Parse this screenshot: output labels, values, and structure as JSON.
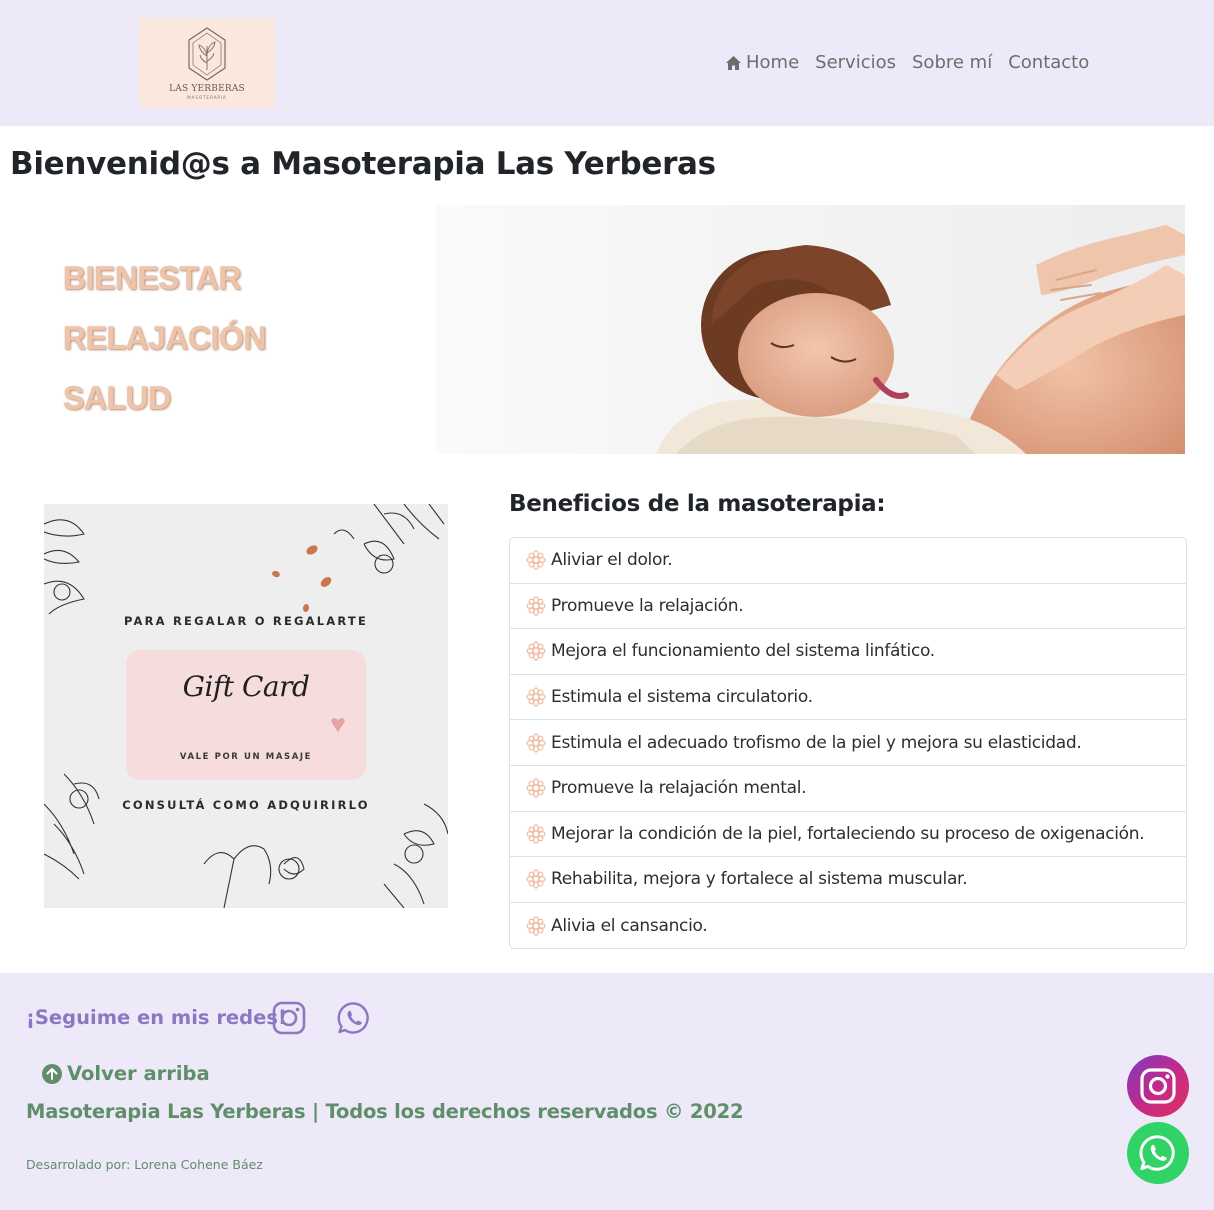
{
  "header": {
    "logo": {
      "name": "LAS YERBERAS",
      "subtitle": "MASOTERAPIA"
    },
    "nav": [
      {
        "label": "Home",
        "icon": "home-icon"
      },
      {
        "label": "Servicios"
      },
      {
        "label": "Sobre mí"
      },
      {
        "label": "Contacto"
      }
    ]
  },
  "main": {
    "title": "Bienvenid@s a Masoterapia Las Yerberas",
    "hero_words": [
      "BIENESTAR",
      "RELAJACIÓN",
      "SALUD"
    ],
    "gift_card": {
      "top_text": "PARA REGALAR O REGALARTE",
      "title": "Gift Card",
      "subtitle": "VALE POR UN MASAJE",
      "bottom_text": "CONSULTÁ COMO ADQUIRIRLO"
    },
    "benefits": {
      "title": "Beneficios de la masoterapia:",
      "items": [
        "Aliviar el dolor.",
        "Promueve la relajación.",
        "Mejora el funcionamiento del sistema linfático.",
        "Estimula el sistema circulatorio.",
        "Estimula el adecuado trofismo de la piel y mejora su elasticidad.",
        "Promueve la relajación mental.",
        "Mejorar la condición de la piel, fortaleciendo su proceso de oxigenación.",
        "Rehabilita, mejora y fortalece al sistema muscular.",
        "Alivia el cansancio."
      ]
    }
  },
  "footer": {
    "follow_label": "¡Seguime en mis redes!",
    "back_to_top": "Volver arriba",
    "copyright": "Masoterapia Las Yerberas | Todos los derechos reservados © 2022",
    "developer": "Desarrolado por: Lorena Cohene Báez"
  },
  "colors": {
    "header_bg": "#eee9f8",
    "hero_text": "#eec4aa",
    "footer_purple": "#8e77c2",
    "footer_green": "#5e8f69",
    "whatsapp": "#2fd366"
  }
}
